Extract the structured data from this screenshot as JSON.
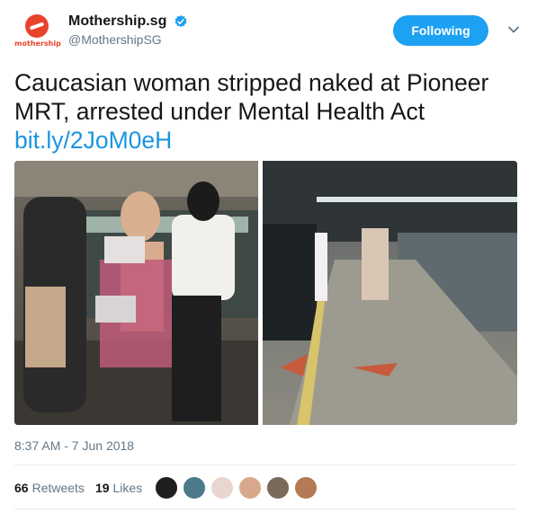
{
  "account": {
    "display_name": "Mothership.sg",
    "handle": "@MothershipSG",
    "logo_text": "mothership",
    "verified": true
  },
  "follow_button": {
    "label": "Following"
  },
  "tweet": {
    "text": "Caucasian woman stripped naked at Pioneer MRT, arrested under Mental Health Act ",
    "link": "bit.ly/2JoM0eH",
    "timestamp": "8:37 AM - 7 Jun 2018"
  },
  "stats": {
    "retweets_count": "66",
    "retweets_label": "Retweets",
    "likes_count": "19",
    "likes_label": "Likes"
  },
  "colors": {
    "accent": "#1da1f2",
    "link": "#1b95e0",
    "brand": "#e8432d",
    "muted": "#657786"
  },
  "icons": [
    "verified-badge-icon",
    "chevron-down-icon"
  ]
}
